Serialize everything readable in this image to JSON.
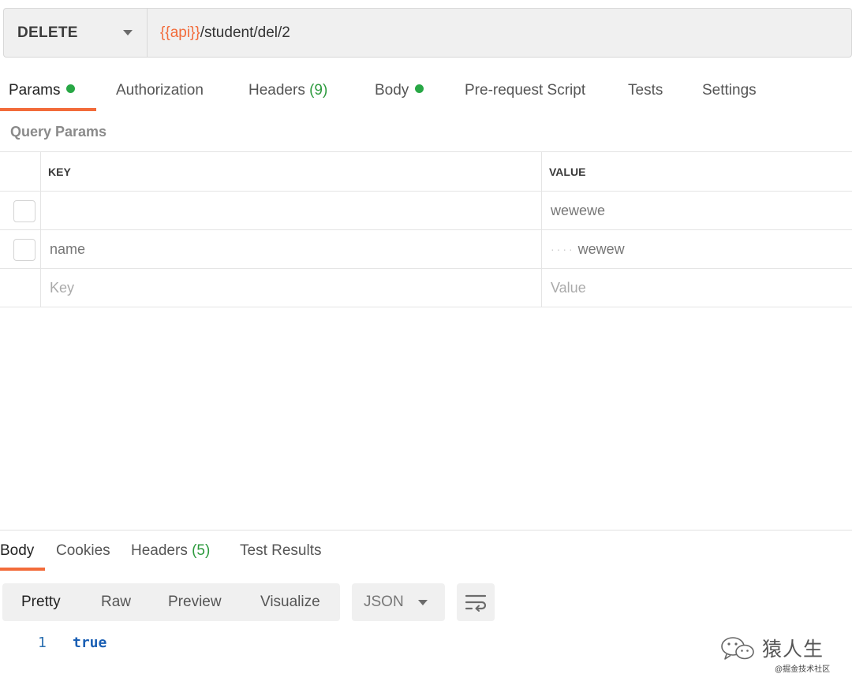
{
  "request": {
    "method": "DELETE",
    "url_variable": "{{api}}",
    "url_path": "/student/del/2"
  },
  "request_tabs": [
    {
      "label": "Params",
      "active": true,
      "dot": true
    },
    {
      "label": "Authorization"
    },
    {
      "label": "Headers",
      "count": "(9)"
    },
    {
      "label": "Body",
      "dot": true
    },
    {
      "label": "Pre-request Script"
    },
    {
      "label": "Tests"
    },
    {
      "label": "Settings"
    }
  ],
  "query_params": {
    "title": "Query Params",
    "columns": {
      "key": "KEY",
      "value": "VALUE"
    },
    "rows": [
      {
        "key": "",
        "value": "wewewe"
      },
      {
        "key": "name",
        "value": "wewew",
        "value_prefix": "····"
      }
    ],
    "new_row": {
      "key_placeholder": "Key",
      "value_placeholder": "Value"
    }
  },
  "response_tabs": [
    {
      "label": "Body",
      "active": true
    },
    {
      "label": "Cookies"
    },
    {
      "label": "Headers",
      "count": "(5)"
    },
    {
      "label": "Test Results"
    }
  ],
  "response_view": {
    "modes": [
      "Pretty",
      "Raw",
      "Preview",
      "Visualize"
    ],
    "active_mode": "Pretty",
    "format": "JSON",
    "wrap_icon": "wrap-lines-icon"
  },
  "response_body": {
    "lines": [
      {
        "number": "1",
        "text": "true"
      }
    ]
  },
  "watermark": {
    "title": "猿人生",
    "subtitle": "@掘金技术社区",
    "icon": "wechat-icon"
  },
  "colors": {
    "accent": "#f26b3a",
    "status_dot": "#28a745",
    "count_green": "#2d9a3e",
    "code_blue": "#1a5fb4"
  }
}
